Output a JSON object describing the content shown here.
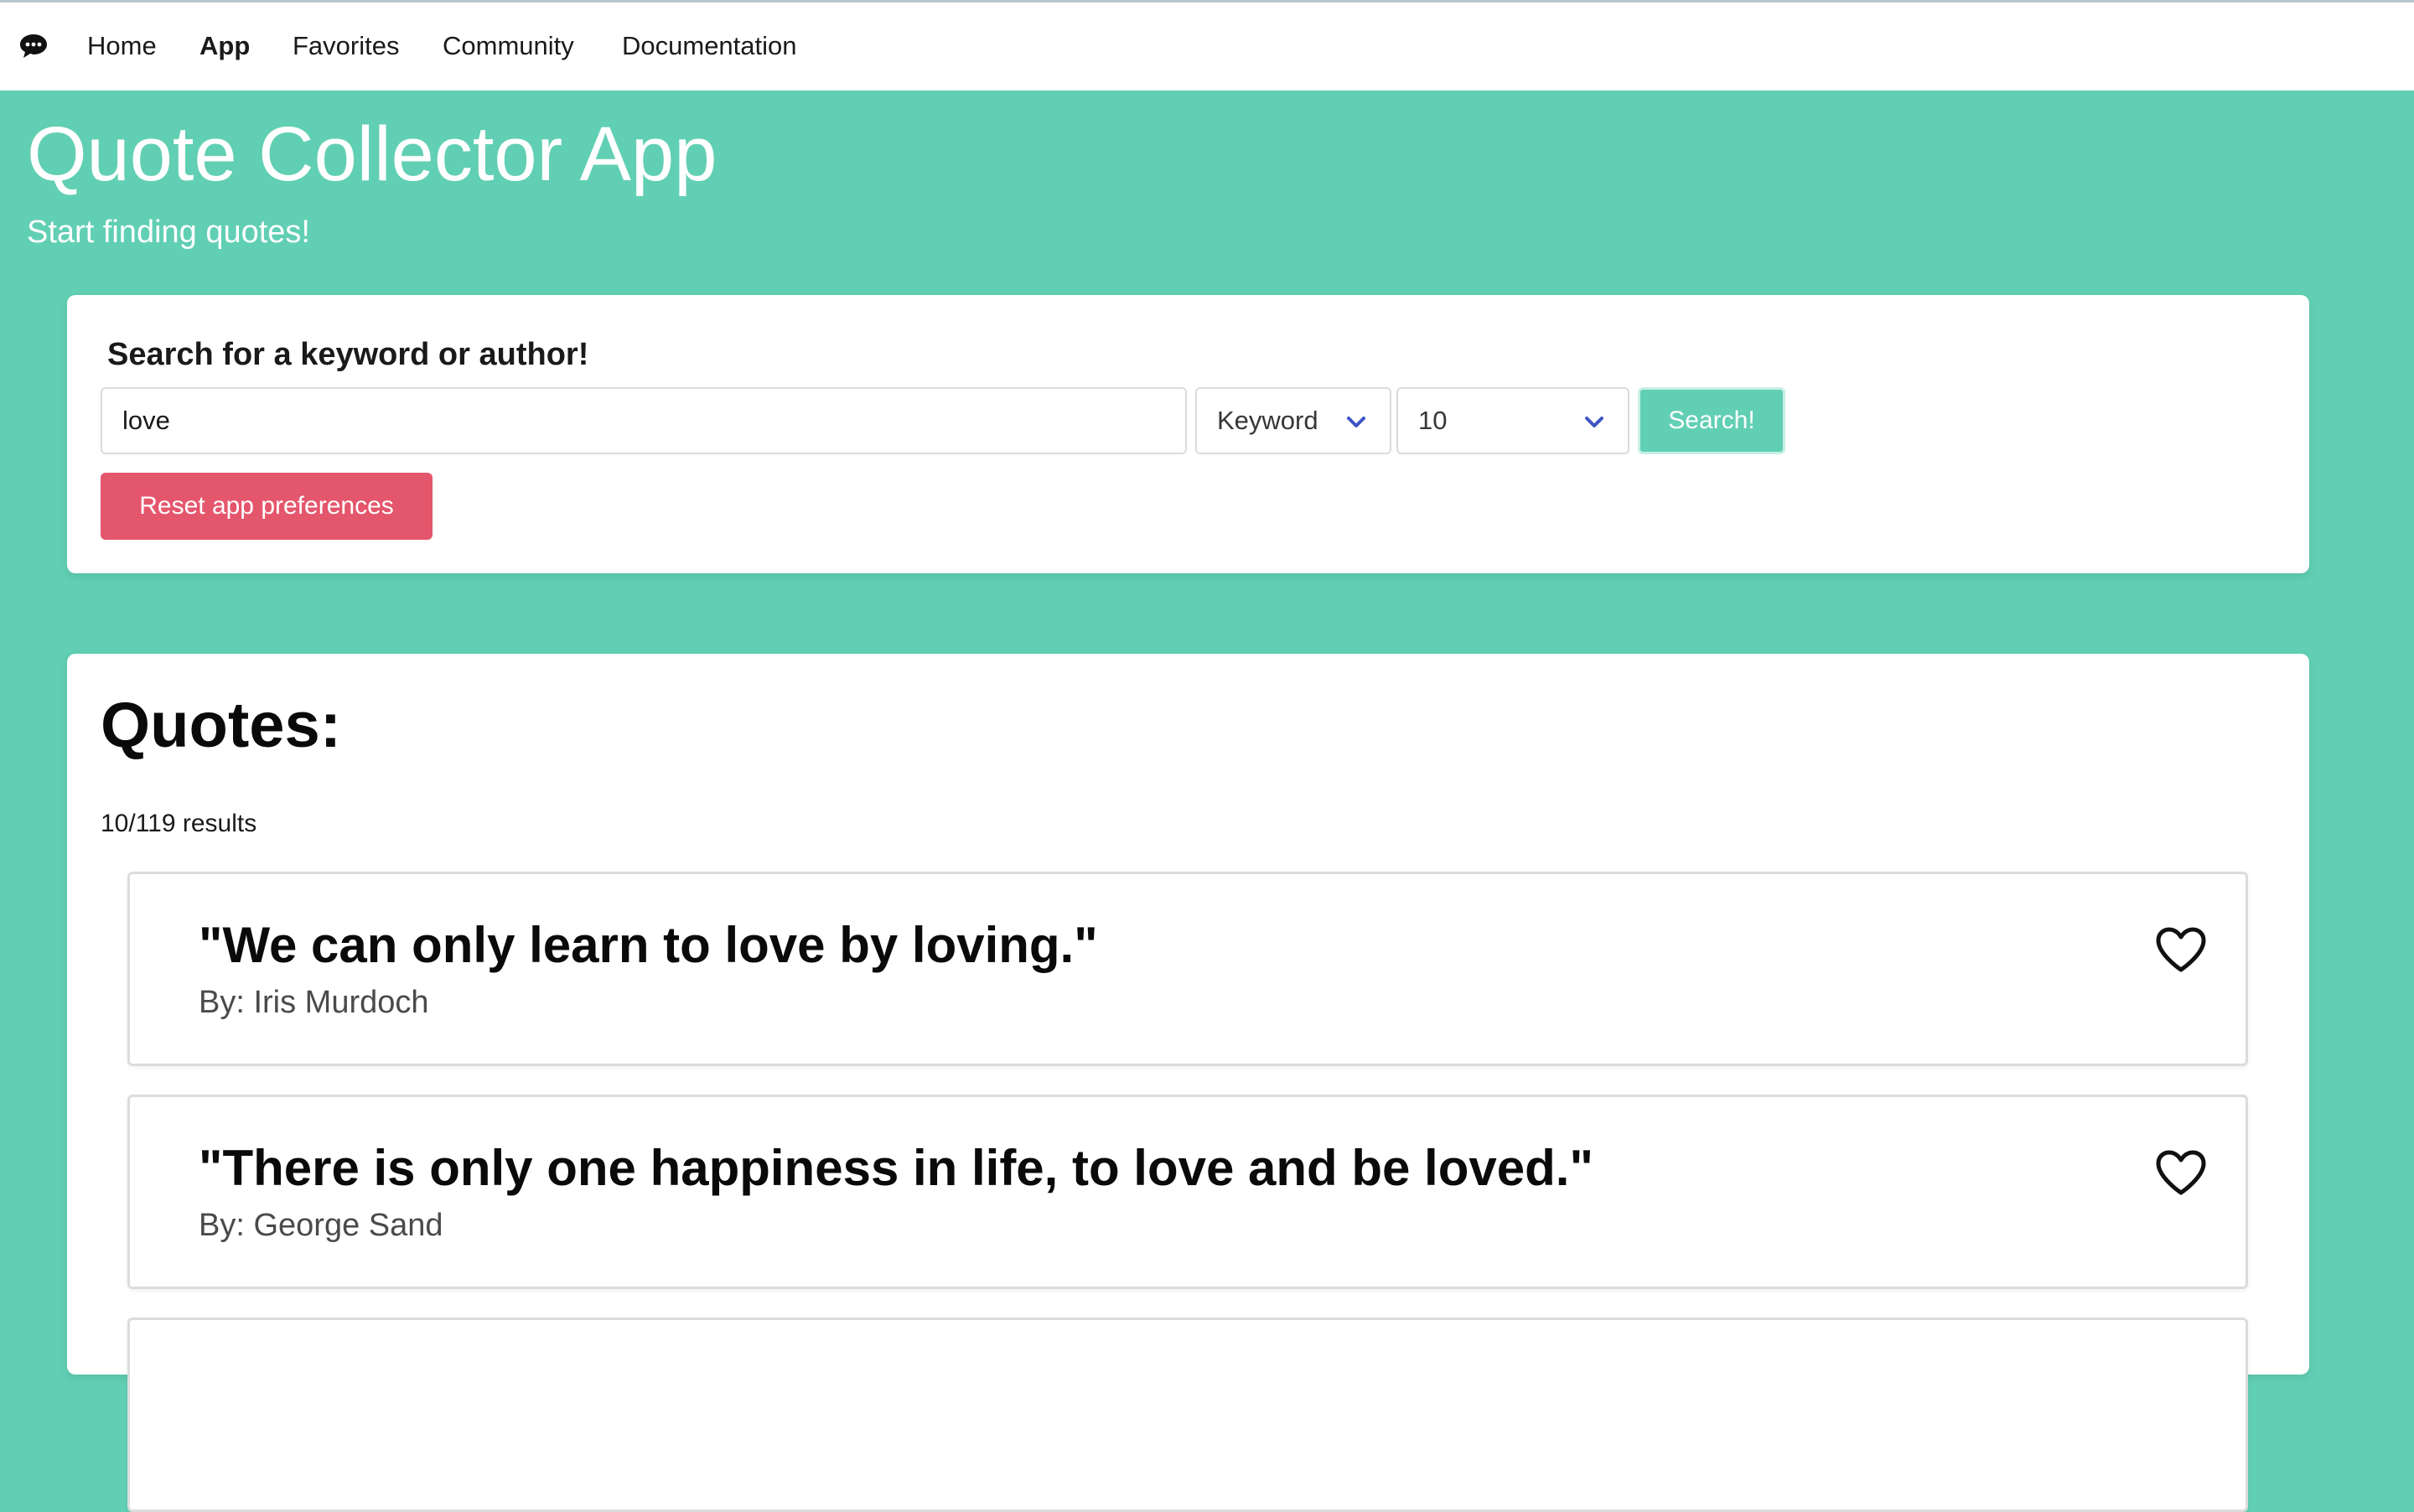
{
  "nav": {
    "brand_icon": "speech-bubble-icon",
    "items": [
      {
        "label": "Home",
        "active": false
      },
      {
        "label": "App",
        "active": true
      },
      {
        "label": "Favorites",
        "active": false
      },
      {
        "label": "Community",
        "active": false
      },
      {
        "label": "Documentation",
        "active": false
      }
    ]
  },
  "hero": {
    "title": "Quote Collector App",
    "subtitle": "Start finding quotes!"
  },
  "search": {
    "label": "Search for a keyword or author!",
    "query_value": "love",
    "mode_selected": "Keyword",
    "count_selected": "10",
    "search_button": "Search!",
    "reset_button": "Reset app preferences"
  },
  "quotes": {
    "heading": "Quotes:",
    "result_count": "10/119 results",
    "items": [
      {
        "text": "\"We can only learn to love by loving.\"",
        "author": "By: Iris Murdoch",
        "icon": "heart-outline-icon"
      },
      {
        "text": "\"There is only one happiness in life, to love and be loved.\"",
        "author": "By: George Sand",
        "icon": "heart-outline-icon"
      }
    ]
  },
  "colors": {
    "background": "#61cfb3",
    "search_button": "#61cfb3",
    "reset_button": "#e4566c",
    "chevron": "#3e56c4"
  }
}
